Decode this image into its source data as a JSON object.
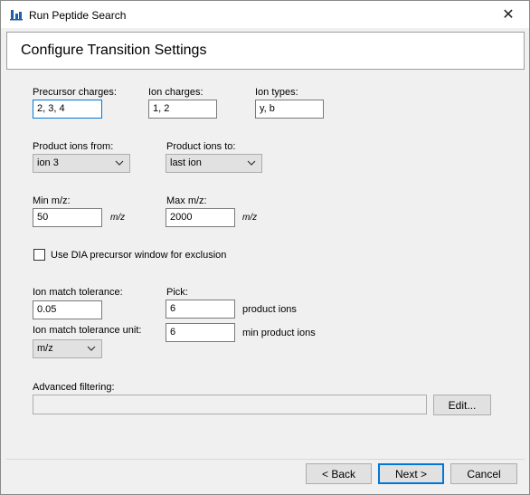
{
  "window": {
    "title": "Run Peptide Search",
    "close_symbol": "✕"
  },
  "header": {
    "title": "Configure Transition Settings"
  },
  "precursor_charges": {
    "label": "Precursor charges:",
    "value": "2, 3, 4"
  },
  "ion_charges": {
    "label": "Ion charges:",
    "value": "1, 2"
  },
  "ion_types": {
    "label": "Ion types:",
    "value": "y, b"
  },
  "product_ions_from": {
    "label": "Product ions from:",
    "selected": "ion 3"
  },
  "product_ions_to": {
    "label": "Product ions to:",
    "selected": "last ion"
  },
  "min_mz": {
    "label": "Min m/z:",
    "value": "50",
    "unit": "m/z"
  },
  "max_mz": {
    "label": "Max m/z:",
    "value": "2000",
    "unit": "m/z"
  },
  "dia_exclusion": {
    "label": "Use DIA precursor window for exclusion",
    "checked": false
  },
  "ion_match_tolerance": {
    "label": "Ion match tolerance:",
    "value": "0.05"
  },
  "ion_match_tolerance_unit": {
    "label": "Ion match tolerance unit:",
    "selected": "m/z"
  },
  "pick": {
    "label": "Pick:",
    "product_ions_value": "6",
    "product_ions_label": "product ions",
    "min_product_ions_value": "6",
    "min_product_ions_label": "min product ions"
  },
  "advanced_filtering": {
    "label": "Advanced filtering:",
    "value": "",
    "edit_button": "Edit..."
  },
  "footer": {
    "back": "< Back",
    "next": "Next >",
    "cancel": "Cancel"
  }
}
